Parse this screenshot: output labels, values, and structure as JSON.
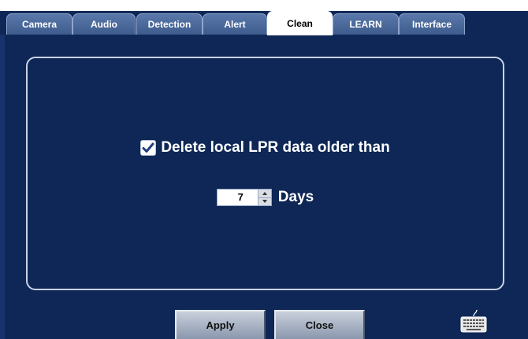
{
  "tabs": [
    {
      "label": "Camera"
    },
    {
      "label": "Audio"
    },
    {
      "label": "Detection"
    },
    {
      "label": "Alert"
    },
    {
      "label": "Clean"
    },
    {
      "label": "LEARN"
    },
    {
      "label": "Interface"
    }
  ],
  "active_tab": "Clean",
  "clean": {
    "delete_label": "Delete local LPR data older than",
    "delete_checked": true,
    "days_value": "7",
    "days_label": "Days"
  },
  "buttons": {
    "apply": "Apply",
    "close": "Close"
  },
  "icons": {
    "keyboard": "keyboard-icon",
    "checkmark": "checkmark-icon"
  },
  "colors": {
    "background": "#0e2756",
    "tab": "#4a6a9e",
    "active_tab": "#ffffff",
    "panel_border": "#c9d3e6"
  }
}
